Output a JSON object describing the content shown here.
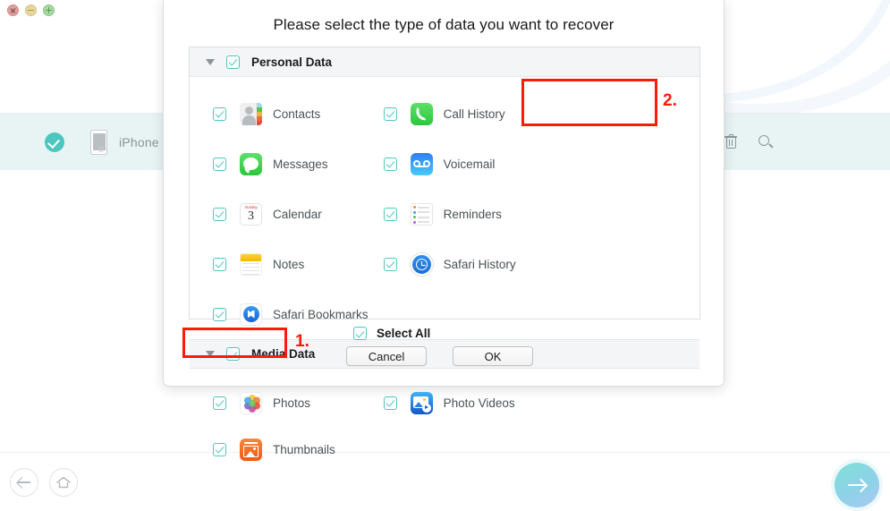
{
  "window": {
    "traffic_lights": [
      "close",
      "minimize",
      "zoom"
    ],
    "device": {
      "status_icon": "check-circle-icon",
      "device_icon": "iphone-icon",
      "label": "iPhone"
    },
    "row_tools": [
      {
        "name": "trash-icon",
        "label": "Delete"
      },
      {
        "name": "search-icon",
        "label": "Search"
      }
    ],
    "bottom_nav": {
      "back_icon": "arrow-left-icon",
      "home_icon": "home-icon",
      "next_icon": "arrow-right-icon"
    }
  },
  "dialog": {
    "title": "Please select the type of data you want to recover",
    "groups": [
      {
        "id": "personal",
        "label": "Personal Data",
        "checked": true,
        "expanded": true,
        "items": [
          {
            "label": "Contacts",
            "icon": "contacts-icon",
            "checked": true
          },
          {
            "label": "Call History",
            "icon": "call-history-icon",
            "checked": true
          },
          {
            "label": "Messages",
            "icon": "messages-icon",
            "checked": true
          },
          {
            "label": "Voicemail",
            "icon": "voicemail-icon",
            "checked": true
          },
          {
            "label": "Calendar",
            "icon": "calendar-icon",
            "checked": true
          },
          {
            "label": "Reminders",
            "icon": "reminders-icon",
            "checked": true
          },
          {
            "label": "Notes",
            "icon": "notes-icon",
            "checked": true
          },
          {
            "label": "Safari History",
            "icon": "safari-history-icon",
            "checked": true
          },
          {
            "label": "Safari Bookmarks",
            "icon": "safari-bookmarks-icon",
            "checked": true
          }
        ]
      },
      {
        "id": "media",
        "label": "Media Data",
        "checked": true,
        "expanded": true,
        "items": [
          {
            "label": "Photos",
            "icon": "photos-icon",
            "checked": true
          },
          {
            "label": "Photo Videos",
            "icon": "photo-videos-icon",
            "checked": true
          },
          {
            "label": "Thumbnails",
            "icon": "thumbnails-icon",
            "checked": true
          }
        ]
      }
    ],
    "calendar_icon_text": {
      "weekday": "Sunday",
      "day": "3"
    },
    "select_all": {
      "label": "Select All",
      "checked": true
    },
    "buttons": {
      "cancel": "Cancel",
      "ok": "OK"
    }
  },
  "annotations": [
    {
      "id": "step1",
      "number": "1.",
      "target": "select-all"
    },
    {
      "id": "step2",
      "number": "2.",
      "target": "messages"
    }
  ],
  "colors": {
    "accent_teal": "#4ec6c0",
    "annotation_red": "#fc1a0a",
    "device_row_bg": "#e8f4f4",
    "group_header_bg": "#f4f5f6"
  }
}
